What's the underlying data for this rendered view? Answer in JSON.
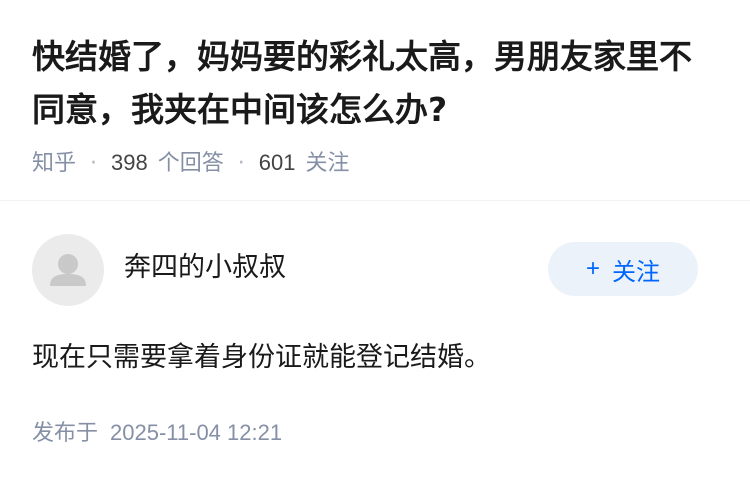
{
  "question": {
    "title": "快结婚了，妈妈要的彩礼太高，男朋友家里不同意，我夹在中间该怎么办?",
    "meta": {
      "site_name": "知乎",
      "answers_count": "398",
      "answers_label": "个回答",
      "followers_count": "601",
      "followers_label": "关注"
    }
  },
  "answer": {
    "author": {
      "name": "奔四的小叔叔",
      "avatar_icon": "default-user-avatar-icon"
    },
    "follow_button": {
      "plus_icon": "+",
      "label": "关注"
    },
    "content": "现在只需要拿着身份证就能登记结婚。",
    "footer": {
      "published_label": "发布于",
      "published_time": "2025-11-04 12:21"
    }
  },
  "colors": {
    "title_text": "#1a1a1a",
    "meta_text": "#8590a6",
    "follow_button_bg": "#ebf2fa",
    "follow_button_text": "#0066ff",
    "avatar_bg": "#ebebeb"
  }
}
